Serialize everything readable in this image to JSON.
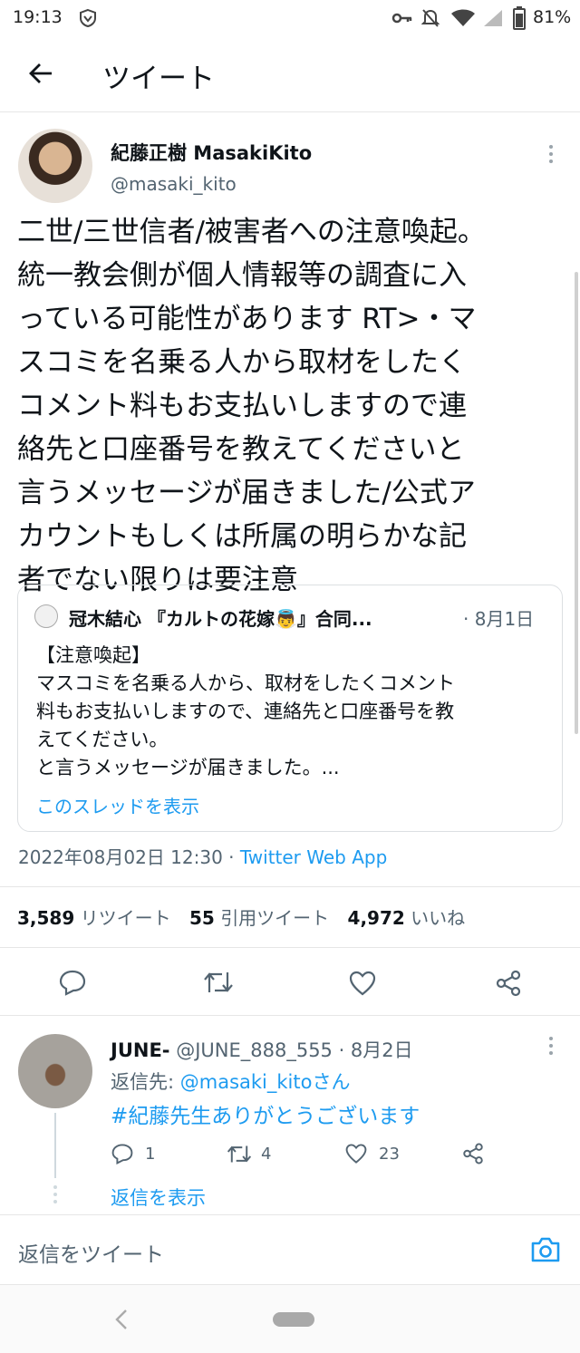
{
  "status": {
    "time": "19:13",
    "battery": "81%"
  },
  "header": {
    "title": "ツイート"
  },
  "tweet": {
    "name": "紀藤正樹 MasakiKito",
    "handle": "@masaki_kito",
    "lines": [
      "二世/三世信者/被害者への注意喚起。",
      "統一教会側が個人情報等の調査に入",
      "っている可能性があります RT>・マ",
      "スコミを名乗る人から取材をしたく",
      "コメント料もお支払いしますので連",
      "絡先と口座番号を教えてくださいと",
      "言うメッセージが届きました/公式ア",
      "カウントもしくは所属の明らかな記",
      "者でない限りは要注意"
    ],
    "quote": {
      "name": "冠木結心 『カルトの花嫁👼』合同...",
      "date": "· 8月1日",
      "lines": [
        "【注意喚起】",
        "マスコミを名乗る人から、取材をしたくコメント",
        "料もお支払いしますので、連絡先と口座番号を教",
        "えてください。",
        "と言うメッセージが届きました。..."
      ],
      "thread_link": "このスレッドを表示"
    },
    "timestamp": "2022年08月02日 12:30 · ",
    "source": "Twitter Web App",
    "stats": {
      "retweets_count": "3,589",
      "retweets_label": "リツイート",
      "quotes_count": "55",
      "quotes_label": "引用ツイート",
      "likes_count": "4,972",
      "likes_label": "いいね"
    }
  },
  "reply": {
    "name": "JUNE-",
    "handle_date": "@JUNE_888_555 · 8月2日",
    "reply_to_prefix": "返信先: ",
    "reply_to_handle": "@masaki_kitoさん",
    "text": "#紀藤先生ありがとうございます",
    "counts": {
      "replies": "1",
      "retweets": "4",
      "likes": "23"
    },
    "show_replies": "返信を表示"
  },
  "composer": {
    "placeholder": "返信をツイート"
  }
}
